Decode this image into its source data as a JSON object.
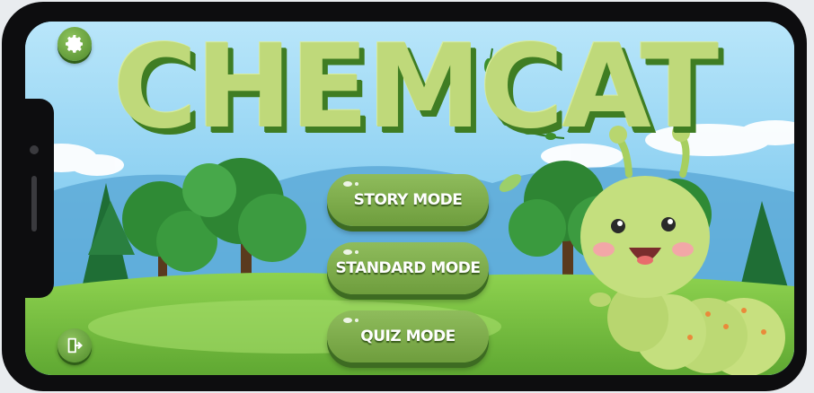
{
  "game": {
    "title": "CHEMCAT",
    "buttons": {
      "story": "STORY MODE",
      "standard": "STANDARD MODE",
      "quiz": "QUIZ MODE"
    },
    "icons": {
      "settings": "gear-icon",
      "exit": "exit-door-icon"
    }
  },
  "colors": {
    "title_fill": "#bfd97a",
    "title_shadow": "#3f7d23",
    "button_fill": "#7aa84a",
    "button_shadow": "#3d6b22",
    "sky": "#7cc7ef",
    "grass": "#7cc441",
    "caterpillar": "#c4df7e"
  }
}
